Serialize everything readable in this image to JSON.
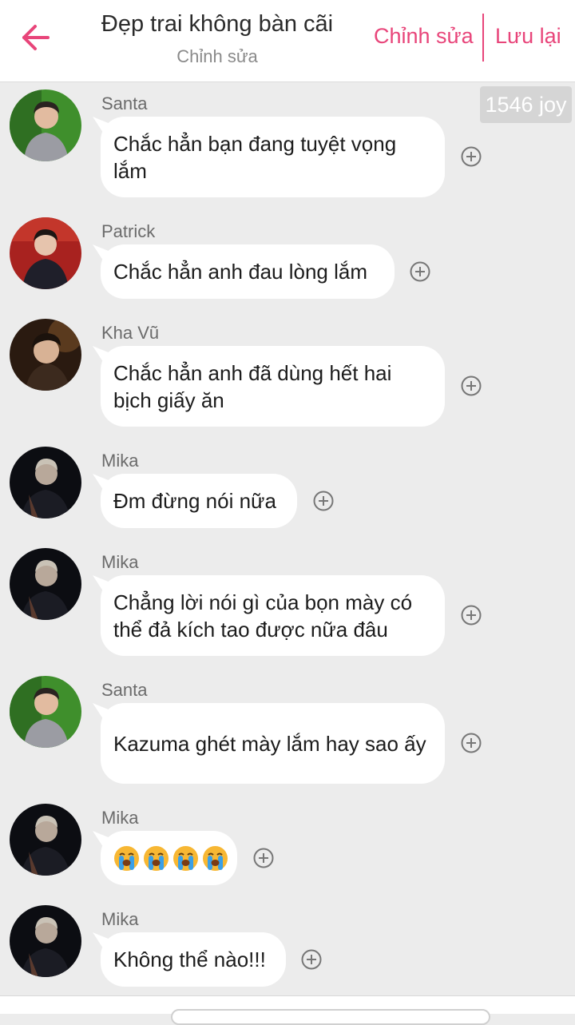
{
  "header": {
    "title": "Đẹp trai không bàn cãi",
    "subtitle": "Chỉnh sửa",
    "edit_label": "Chỉnh sửa",
    "save_label": "Lưu lại",
    "accent_color": "#e8457a"
  },
  "joy_badge": "1546 joy",
  "messages": [
    {
      "sender": "Santa",
      "text": "Chắc hẳn bạn đang tuyệt vọng lắm"
    },
    {
      "sender": "Patrick",
      "text": "Chắc hẳn anh đau lòng lắm"
    },
    {
      "sender": "Kha Vũ",
      "text": "Chắc hẳn anh đã dùng hết hai bịch giấy ăn"
    },
    {
      "sender": "Mika",
      "text": "Đm đừng nói nữa"
    },
    {
      "sender": "Mika",
      "text": "Chẳng lời nói gì của bọn mày có thể đả kích tao được nữa đâu"
    },
    {
      "sender": "Santa",
      "text": "Kazuma ghét mày lắm hay sao ấy"
    },
    {
      "sender": "Mika",
      "text": "",
      "emoji": [
        "loudly-crying-face",
        "loudly-crying-face",
        "loudly-crying-face",
        "loudly-crying-face"
      ]
    },
    {
      "sender": "Mika",
      "text": "Không thể nào!!!"
    }
  ]
}
